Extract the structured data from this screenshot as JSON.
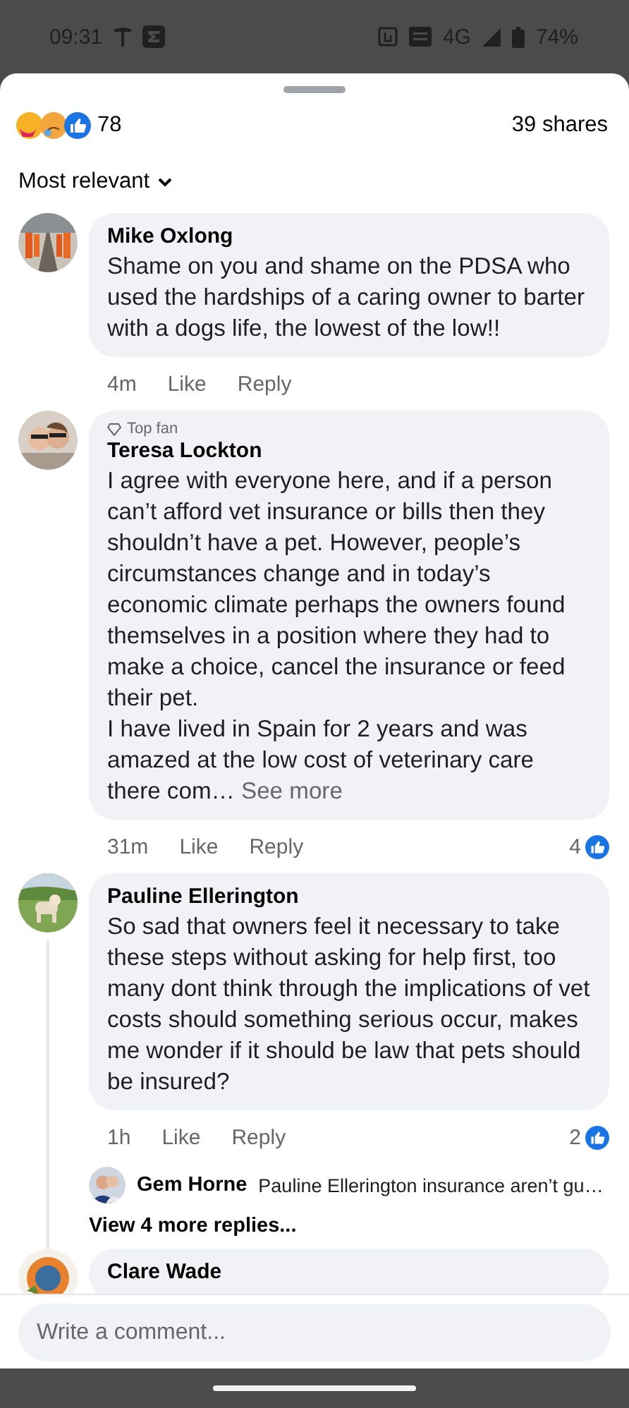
{
  "status_bar": {
    "time": "09:31",
    "network": "4G",
    "battery": "74%"
  },
  "summary": {
    "reaction_count": "78",
    "shares": "39 shares"
  },
  "sort": {
    "label": "Most relevant"
  },
  "comments": [
    {
      "name": "Mike Oxlong",
      "text": "Shame on you and shame on the PDSA who used the hardships of a caring owner to barter with a dogs life, the lowest of the low!!",
      "time": "4m",
      "like": "Like",
      "reply": "Reply"
    },
    {
      "name": "Teresa Lockton",
      "badge": "Top fan",
      "text": "I agree with everyone here, and if a person can’t afford vet insurance or bills then they shouldn’t have a pet. However, people’s circumstances change and in today’s economic climate perhaps the owners found themselves in a position where they had to make a choice, cancel the insurance or feed their pet.\nI have lived in Spain for 2 years and was amazed at the low cost of veterinary care there com…",
      "see_more": "See more",
      "time": "31m",
      "like": "Like",
      "reply": "Reply",
      "reaction_count": "4"
    },
    {
      "name": "Pauline Ellerington",
      "text": "So sad that owners feel it necessary to take these steps without asking for help first, too many dont think through the implications of vet costs should something serious occur, makes me wonder if it should be law that pets should be insured?",
      "time": "1h",
      "like": "Like",
      "reply": "Reply",
      "reaction_count": "2",
      "replies": [
        {
          "name": "Gem Horne",
          "text": "Pauline Ellerington insurance aren’t gu…"
        }
      ],
      "more_replies": "View 4 more replies..."
    },
    {
      "name": "Clare Wade"
    }
  ],
  "composer": {
    "placeholder": "Write a comment..."
  }
}
